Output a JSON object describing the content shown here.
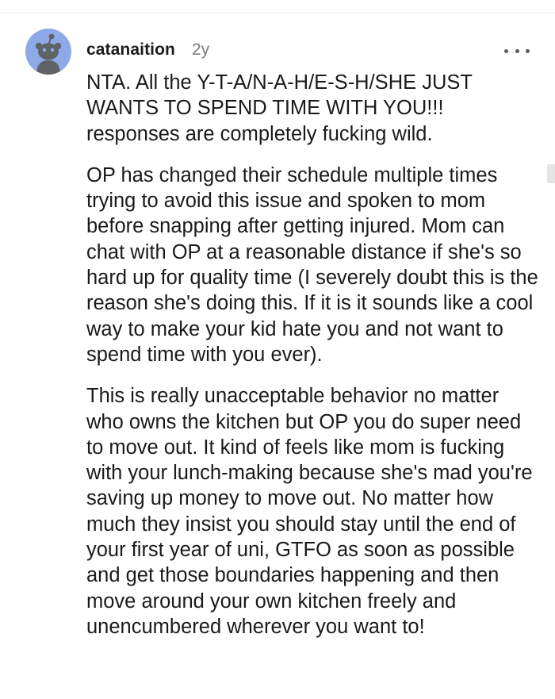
{
  "comment": {
    "username": "catanaition",
    "age": "2y",
    "avatar_icon": "reddit-snoo-avatar-icon",
    "more_icon": "more-options-icon",
    "paragraphs": [
      "NTA. All the Y-T-A/N-A-H/E-S-H/SHE JUST WANTS TO SPEND TIME WITH YOU!!! responses are completely fucking wild.",
      "OP has changed their schedule multiple times trying to avoid this issue and spoken to mom before snapping after getting injured. Mom can chat with OP at a reasonable distance if she's so hard up for quality time (I severely doubt this is the reason she's doing this. If it is it sounds like a cool way to make your kid hate you and not want to spend time with you ever).",
      "This is really unacceptable behavior no matter who owns the kitchen but OP you do super need to move out. It kind of feels like mom is fucking with your lunch-making because she's mad you're saving up money to move out. No matter how much they insist you should stay until the end of your first year of uni, GTFO as soon as possible and get those boundaries happening and then move around your own kitchen freely and unencumbered wherever you want to!"
    ]
  },
  "colors": {
    "avatar_bg": "#8ea9e8",
    "username": "#1c1c1c",
    "meta": "#7c7c7c",
    "text": "#1a1a1b"
  }
}
